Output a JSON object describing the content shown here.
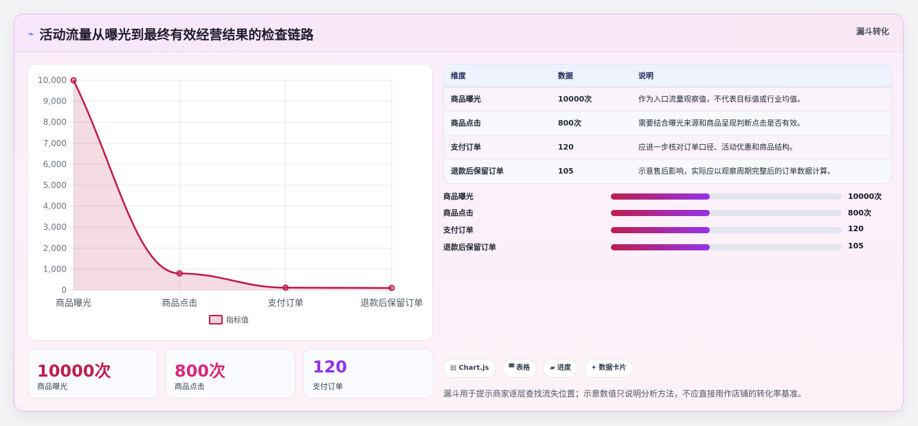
{
  "header": {
    "icon": "chart-line-icon",
    "title": "活动流量从曝光到最终有效经营结果的检查链路",
    "tag": "漏斗转化"
  },
  "chart_data": {
    "type": "line",
    "categories": [
      "商品曝光",
      "商品点击",
      "支付订单",
      "退款后保留订单"
    ],
    "series": [
      {
        "name": "指标值",
        "values": [
          10000,
          800,
          120,
          105
        ]
      }
    ],
    "ylim": [
      0,
      10000
    ],
    "yticks": [
      "0",
      "1,000",
      "2,000",
      "3,000",
      "4,000",
      "5,000",
      "6,000",
      "7,000",
      "8,000",
      "9,000",
      "10,000"
    ],
    "fill": true,
    "color": "#be1e4d",
    "grid": true,
    "legend": "bottom"
  },
  "stats": [
    {
      "value": "10000次",
      "label": "商品曝光",
      "color": "#be1e4d"
    },
    {
      "value": "800次",
      "label": "商品点击",
      "color": "#db2777"
    },
    {
      "value": "120",
      "label": "支付订单",
      "color": "#9333ea"
    }
  ],
  "table": {
    "headers": [
      "维度",
      "数据",
      "说明"
    ],
    "rows": [
      [
        "商品曝光",
        "10000次",
        "作为入口流量观察值，不代表目标值或行业均值。"
      ],
      [
        "商品点击",
        "800次",
        "需要结合曝光来源和商品呈现判断点击是否有效。"
      ],
      [
        "支付订单",
        "120",
        "应进一步核对订单口径、活动优惠和商品结构。"
      ],
      [
        "退款后保留订单",
        "105",
        "示意售后影响，实际应以观察周期完整后的订单数据计算。"
      ]
    ]
  },
  "progress": [
    {
      "label": "商品曝光",
      "value": "10000次",
      "fraction": 0.43
    },
    {
      "label": "商品点击",
      "value": "800次",
      "fraction": 0.43
    },
    {
      "label": "支付订单",
      "value": "120",
      "fraction": 0.43
    },
    {
      "label": "退款后保留订单",
      "value": "105",
      "fraction": 0.43
    }
  ],
  "pills": [
    {
      "icon": "chart-icon",
      "glyph": "▤",
      "label": "Chart.js"
    },
    {
      "icon": "table-icon",
      "glyph": "▀",
      "label": "表格"
    },
    {
      "icon": "progress-icon",
      "glyph": "▰",
      "label": "进度"
    },
    {
      "icon": "sparkle-icon",
      "glyph": "✦",
      "label": "数据卡片"
    }
  ],
  "note": "漏斗用于提示商家逐层查找流失位置；示意数值只说明分析方法，不应直接用作店铺的转化率基准。"
}
